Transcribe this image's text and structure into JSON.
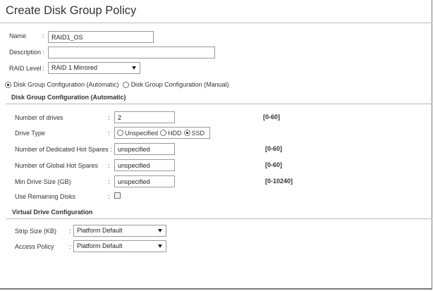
{
  "dialog": {
    "title": "Create Disk Group Policy"
  },
  "form": {
    "name_label": "Name",
    "name_sep": ":",
    "name_value": "RAID1_OS",
    "description_label": "Description :",
    "description_value": "",
    "raid_level_label": "RAID Level",
    "raid_level_sep": ":",
    "raid_level_value": "RAID 1 Mirrored"
  },
  "config_mode": {
    "automatic_label": "Disk Group Configuration (Automatic)",
    "manual_label": "Disk Group Configuration (Manual)",
    "selected": "automatic"
  },
  "auto_section": {
    "heading": "Disk Group Configuration (Automatic)",
    "rows": {
      "num_drives": {
        "label": "Number of drives",
        "sep": ":",
        "value": "2",
        "range": "[0-60]"
      },
      "drive_type": {
        "label": "Drive Type",
        "sep": ":",
        "options": [
          "Unspecified",
          "HDD",
          "SSD"
        ],
        "selected": "SSD"
      },
      "dedicated_spares": {
        "label": "Number of Dedicated Hot Spares :",
        "value": "unspecified",
        "range": "[0-60]"
      },
      "global_spares": {
        "label": "Number of Global Hot Spares",
        "sep": ":",
        "value": "unspecified",
        "range": "[0-60]"
      },
      "min_drive_size": {
        "label": "Min Drive Size (GB)",
        "sep": ":",
        "value": "unspecified",
        "range": "[0-10240]"
      },
      "use_remaining": {
        "label": "Use Remaining Disks",
        "sep": ":",
        "checked": false
      }
    }
  },
  "virtual_section": {
    "heading": "Virtual Drive Configuration",
    "strip_size": {
      "label": "Strip Size (KB)",
      "sep": ":",
      "value": "Platform Default"
    },
    "access_policy": {
      "label": "Access Policy",
      "sep": ":",
      "value": "Platform Default"
    }
  }
}
